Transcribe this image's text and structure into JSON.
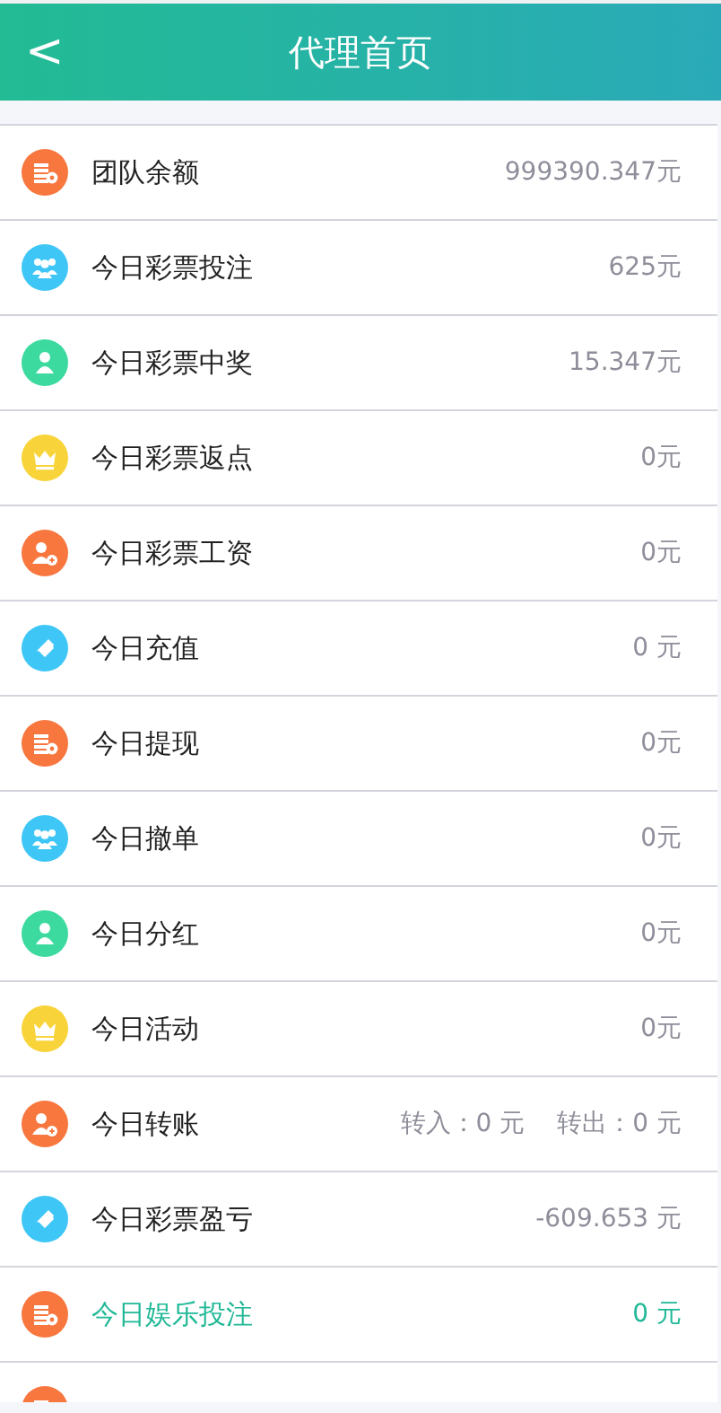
{
  "header": {
    "back": "<",
    "title": "代理首页"
  },
  "items": [
    {
      "kind": "coins",
      "label": "团队余额",
      "values": [
        "999390.347元"
      ],
      "selected": false
    },
    {
      "kind": "people",
      "label": "今日彩票投注",
      "values": [
        "625元"
      ],
      "selected": false
    },
    {
      "kind": "person",
      "label": "今日彩票中奖",
      "values": [
        "15.347元"
      ],
      "selected": false
    },
    {
      "kind": "crown",
      "label": "今日彩票返点",
      "values": [
        "0元"
      ],
      "selected": false
    },
    {
      "kind": "adduser",
      "label": "今日彩票工资",
      "values": [
        "0元"
      ],
      "selected": false
    },
    {
      "kind": "ticket",
      "label": "今日充值",
      "values": [
        "0 元"
      ],
      "selected": false
    },
    {
      "kind": "coins",
      "label": "今日提现",
      "values": [
        "0元"
      ],
      "selected": false
    },
    {
      "kind": "people",
      "label": "今日撤单",
      "values": [
        "0元"
      ],
      "selected": false
    },
    {
      "kind": "person",
      "label": "今日分红",
      "values": [
        "0元"
      ],
      "selected": false
    },
    {
      "kind": "crown",
      "label": "今日活动",
      "values": [
        "0元"
      ],
      "selected": false
    },
    {
      "kind": "adduser",
      "label": "今日转账",
      "values": [
        "转入：0 元",
        "转出：0 元"
      ],
      "selected": false
    },
    {
      "kind": "ticket",
      "label": "今日彩票盈亏",
      "values": [
        "-609.653 元"
      ],
      "selected": false
    },
    {
      "kind": "coins",
      "label": "今日娱乐投注",
      "values": [
        "0 元"
      ],
      "selected": true
    },
    {
      "kind": "coins"
    }
  ]
}
